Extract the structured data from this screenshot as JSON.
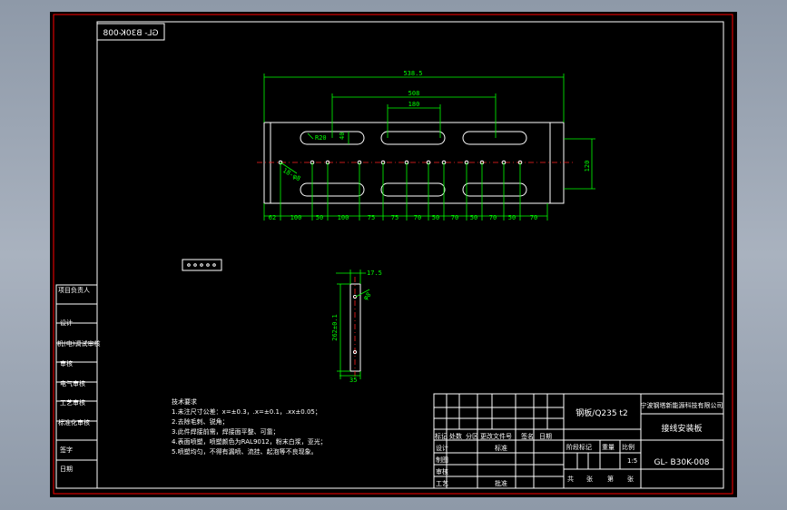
{
  "drawing": {
    "mirrored_code": "GL- B30K-008",
    "dimensions": {
      "overall_width": "538.5",
      "hole_spacing_outer": "508",
      "hole_spacing_inner": "180",
      "slot_radius": "R20",
      "slot_height": "40",
      "hole_spec": "18-φ8",
      "plate_height": "120",
      "bottom_chain": [
        "62",
        "100",
        "50",
        "100",
        "75",
        "75",
        "70",
        "50",
        "70",
        "50",
        "70",
        "50",
        "70"
      ],
      "side_thickness": "17.5",
      "side_hole": "φ8",
      "side_length": "262±0.1",
      "side_width": "35"
    },
    "tech_requirements": {
      "title": "技术要求",
      "items": [
        "1.未注尺寸公差：x=±0.3，.x=±0.1，.xx±0.05；",
        "2.去除毛刺、锐角；",
        "3.此件焊接前需，焊接面平整、可靠；",
        "4.表面喷塑，喷塑颜色为RAL9012，粉末白浆，亚光；",
        "5.喷塑均匀，不得有漏喷、流挂、起泡等不良现象。"
      ]
    },
    "left_strip": [
      "项目负责人",
      "设计",
      "机(电)调试审核",
      "审核",
      "电气审核",
      "工艺审核",
      "标准化审核",
      "签字",
      "日期"
    ],
    "title_block": {
      "material": "钢板/Q235 t2",
      "company": "宁波钢塔新能源科技有限公司",
      "part_name": "接线安装板",
      "drawing_number": "GL- B30K-008",
      "header_row": [
        "标记",
        "处数",
        "分区",
        "更改文件号",
        "签名",
        "日期"
      ],
      "left_rows": [
        "设计",
        "制图",
        "审核",
        "工艺"
      ],
      "standardization": "标准",
      "approval": "批准",
      "stage_label": "阶段标记",
      "weight_label": "重量",
      "scale_label": "比例",
      "scale_value": "1:5",
      "sheet_total": "共",
      "sheet_label": "张",
      "sheet_no": "第",
      "sheet_label2": "张"
    }
  }
}
